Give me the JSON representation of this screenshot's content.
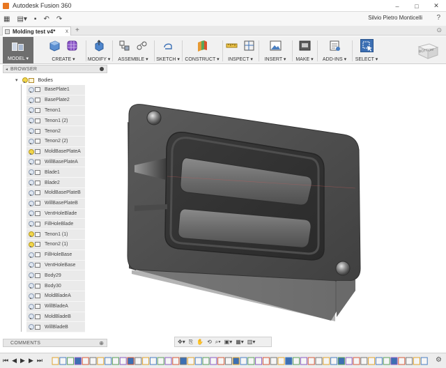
{
  "window": {
    "title": "Autodesk Fusion 360",
    "minimize": "–",
    "maximize": "□",
    "close": "✕"
  },
  "qat": {
    "user": "Silvio Pietro Monticelli",
    "help": "?",
    "grid": "▦",
    "save": "▪",
    "undo": "↶",
    "redo": "↷"
  },
  "tabs": {
    "document": "Molding test v4*",
    "close": "x",
    "add": "+",
    "extra": "⊙"
  },
  "ribbon": {
    "workspace": "MODEL ▾",
    "groups": [
      {
        "label": "CREATE ▾"
      },
      {
        "label": "MODIFY ▾"
      },
      {
        "label": "ASSEMBLE ▾"
      },
      {
        "label": "SKETCH ▾"
      },
      {
        "label": "CONSTRUCT ▾"
      },
      {
        "label": "INSPECT ▾"
      },
      {
        "label": "INSERT ▾"
      },
      {
        "label": "MAKE ▾"
      },
      {
        "label": "ADD-INS ▾"
      },
      {
        "label": "SELECT ▾"
      }
    ],
    "viewcube": "BOTTOM"
  },
  "browser": {
    "title": "BROWSER",
    "arrow": "◂",
    "folder": "Bodies",
    "items": [
      {
        "label": "BasePlate1",
        "on": false
      },
      {
        "label": "BasePlate2",
        "on": false
      },
      {
        "label": "Tenon1",
        "on": false
      },
      {
        "label": "Tenon1 (2)",
        "on": false
      },
      {
        "label": "Tenon2",
        "on": false
      },
      {
        "label": "Tenon2 (2)",
        "on": false
      },
      {
        "label": "MoldBasePlateA",
        "on": true
      },
      {
        "label": "WillBasePlateA",
        "on": false
      },
      {
        "label": "Blade1",
        "on": false
      },
      {
        "label": "Blade2",
        "on": false
      },
      {
        "label": "MoldBasePlateB",
        "on": false
      },
      {
        "label": "WillBasePlateB",
        "on": false
      },
      {
        "label": "VentHoleBlade",
        "on": false
      },
      {
        "label": "FillHoleBlade",
        "on": false
      },
      {
        "label": "Tenon1 (1)",
        "on": true
      },
      {
        "label": "Tenon2 (1)",
        "on": true
      },
      {
        "label": "FillHoleBase",
        "on": false
      },
      {
        "label": "VentHoleBase",
        "on": false
      },
      {
        "label": "Body29",
        "on": false
      },
      {
        "label": "Body30",
        "on": false
      },
      {
        "label": "MoldBladeA",
        "on": false
      },
      {
        "label": "WillBladeA",
        "on": false
      },
      {
        "label": "MoldBladeB",
        "on": false
      },
      {
        "label": "WillBladeB",
        "on": false
      }
    ]
  },
  "comments": {
    "title": "COMMENTS",
    "add": "⊕"
  },
  "navbar": {
    "items": [
      "✥▾",
      "⎘",
      "✋",
      "⟲",
      "⌕▾",
      "▣▾",
      "▦▾",
      "▥▾"
    ]
  },
  "timeline": {
    "controls": [
      "⏮",
      "◀",
      "▶",
      "▶",
      "⏭"
    ],
    "gear": "⚙"
  },
  "colors": {
    "mold": "#5a5a5a",
    "mold_top": "#4b4b4b",
    "mold_side": "#6d6d6d",
    "select_blue": "#3c6fb3",
    "workspace_bg": "#6e6e6e"
  }
}
